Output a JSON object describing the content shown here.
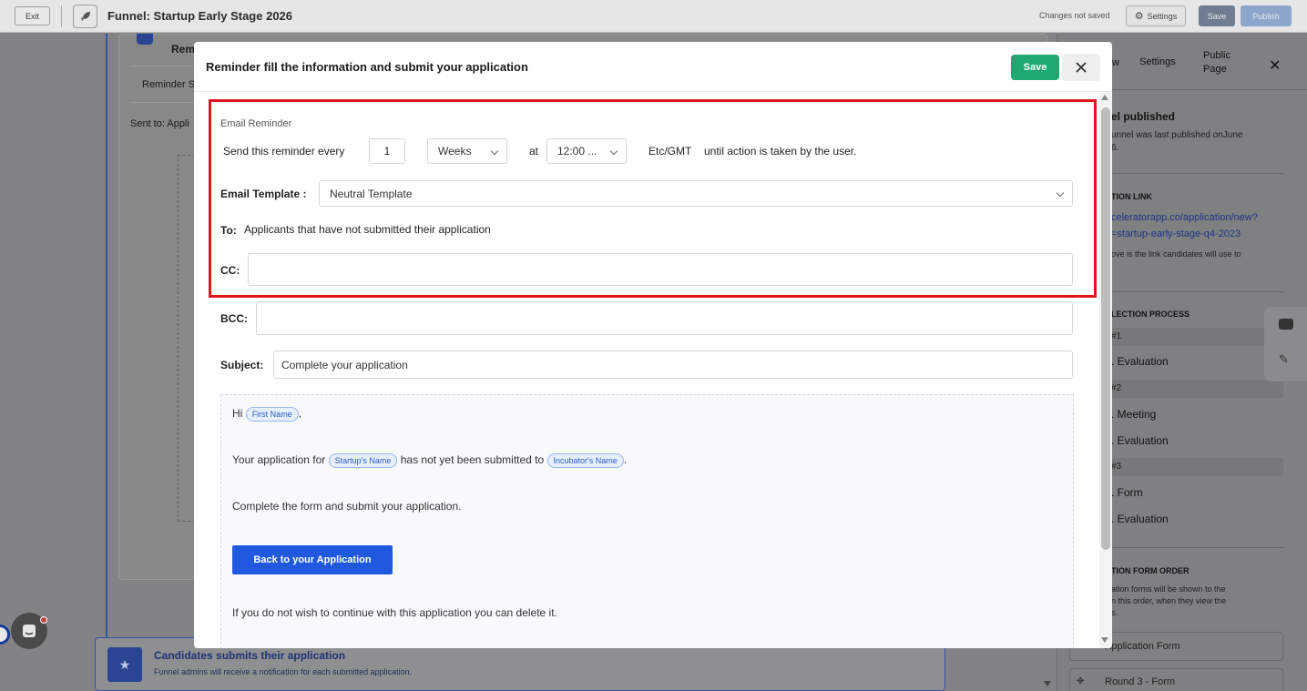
{
  "topbar": {
    "exit_label": "Exit",
    "title": "Funnel: Startup Early Stage 2026",
    "changes_status": "Changes not saved",
    "settings_label": "Settings",
    "save_label": "Save",
    "publish_label": "Publish"
  },
  "background": {
    "card_title_fragment": "Rem",
    "reminder_fragment": "Reminder S",
    "sent_to_fragment": "Sent to: Appli",
    "candidates_title": "Candidates submits their application",
    "candidates_subtitle": "Funnel admins will receive a notification for each submitted application."
  },
  "right_panel": {
    "tabs": [
      "w",
      "Settings",
      "Public Page"
    ],
    "published_title": "el published",
    "published_desc_1": "unnel was last published onJune",
    "published_desc_2": "6.",
    "app_link_head": "TION LINK",
    "link_line_1": "celeratorapp.co/application/new?",
    "link_line_2": "=startup-early-stage-q4-2023",
    "link_note": "ove is the link candidates will use to",
    "selection_head": "LECTION PROCESS",
    "rounds": [
      {
        "label": "#1",
        "items": [
          ". Evaluation"
        ]
      },
      {
        "label": "#2",
        "items": [
          ". Meeting",
          ". Evaluation"
        ]
      },
      {
        "label": "#3",
        "items": [
          ". Form",
          ". Evaluation"
        ]
      }
    ],
    "form_order_head": "TION FORM ORDER",
    "form_order_note_1": "ation forms will be shown to the",
    "form_order_note_2": "n this order, when they view the",
    "form_order_note_3": "s.",
    "form_order_items": [
      "Application Form",
      "Round 3 - Form"
    ]
  },
  "modal": {
    "title": "Reminder fill the information and submit your application",
    "save_label": "Save",
    "section_label": "Email Reminder",
    "send_every_label": "Send this reminder every",
    "interval_value": "1",
    "interval_unit": "Weeks",
    "at_label": "at",
    "time_value": "12:00 ...",
    "timezone": "Etc/GMT",
    "until_label": "until action is taken by the user.",
    "template_label": "Email Template :",
    "template_value": "Neutral Template",
    "to_label": "To:",
    "to_value": "Applicants that have not submitted their application",
    "cc_label": "CC:",
    "cc_value": "",
    "bcc_label": "BCC:",
    "bcc_value": "",
    "subject_label": "Subject:",
    "subject_value": "Complete your application",
    "email_body": {
      "greeting": "Hi",
      "first_name_tag": "First Name",
      "line2_pre": "Your application for",
      "startup_tag": "Startup's Name",
      "line2_mid": "has not yet been submitted to",
      "incubator_tag": "Incubator's Name",
      "line3": "Complete the form and submit your application.",
      "cta_label": "Back to your Application",
      "line4": "If you do not wish to continue with this application you can delete it."
    }
  },
  "colors": {
    "primary_green": "#1fa971",
    "cta_blue": "#2059e0",
    "highlight_red": "#e0161c"
  }
}
